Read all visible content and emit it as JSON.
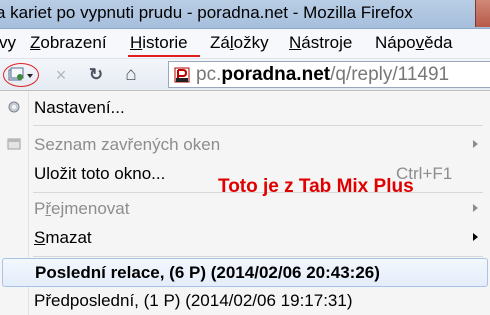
{
  "window": {
    "title": "a kariet po vypnuti prudu - poradna.net - Mozilla Firefox"
  },
  "menubar": {
    "items": [
      {
        "label": "vy",
        "ul": ""
      },
      {
        "pre": "",
        "ul": "Z",
        "post": "obrazení"
      },
      {
        "pre": "",
        "ul": "H",
        "post": "istorie"
      },
      {
        "pre": "Zá",
        "ul": "l",
        "post": "ožky"
      },
      {
        "pre": "",
        "ul": "N",
        "post": "ástroje"
      },
      {
        "pre": "Nápo",
        "ul": "v",
        "post": "ěda"
      }
    ]
  },
  "toolbar": {
    "url_prefix": "pc.",
    "url_domain": "poradna.net",
    "url_path": "/q/reply/11491",
    "back_icon": "tab-mix-session-icon",
    "stop_icon": "×",
    "reload_icon": "↻",
    "home_icon": "⌂"
  },
  "menu": {
    "items": [
      {
        "label": "Nastavení...",
        "disabled": false
      },
      {
        "label": "Seznam zavřených oken",
        "disabled": true,
        "submenu": true
      },
      {
        "label": "Uložit toto okno...",
        "accel": "Ctrl+F1",
        "disabled": false
      },
      {
        "pre": "P",
        "ul": "ř",
        "post": "ejmenovat",
        "disabled": true,
        "submenu": true
      },
      {
        "pre": "",
        "ul": "S",
        "post": "mazat",
        "disabled": false,
        "submenu": true
      },
      {
        "label": "Poslední relace, (6 P) (2014/02/06 20:43:26)",
        "bold": true
      },
      {
        "label": "Předposlední, (1 P) (2014/02/06 19:17:31)"
      }
    ]
  },
  "annotation": {
    "text": "Toto je z Tab Mix Plus",
    "color": "#e00000"
  },
  "colors": {
    "highlight_border": "#a9c2e6",
    "annotation_oval": "#e02020"
  }
}
